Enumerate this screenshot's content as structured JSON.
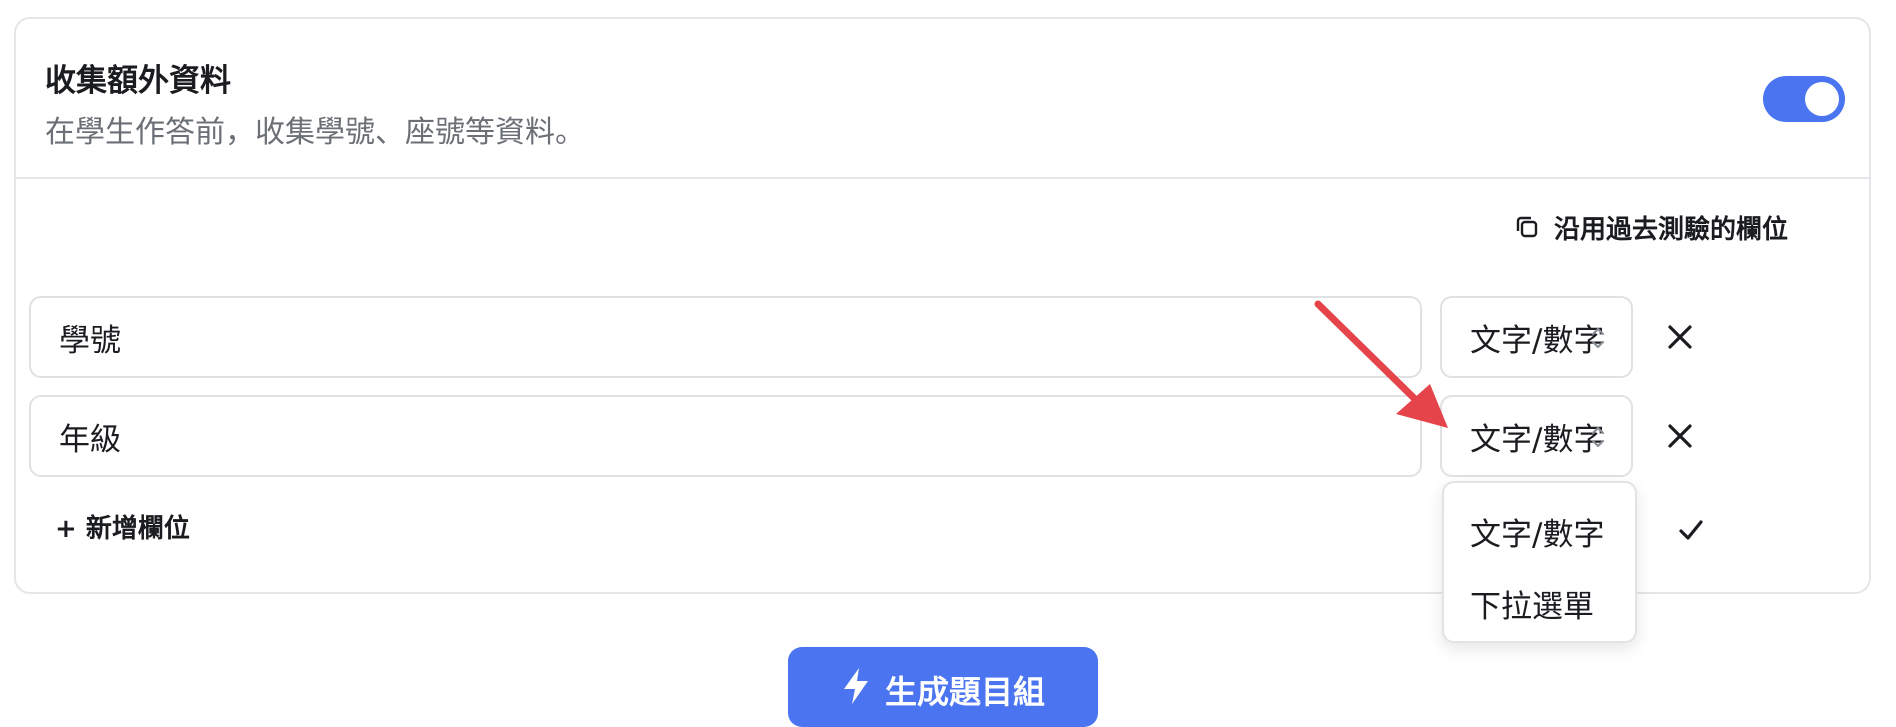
{
  "extra_info": {
    "title": "收集額外資料",
    "description": "在學生作答前，收集學號、座號等資料。",
    "enabled": true
  },
  "reuse_link": {
    "label": "沿用過去測驗的欄位",
    "icon": "copy-icon"
  },
  "fields": [
    {
      "name": "學號",
      "type": "文字/數字"
    },
    {
      "name": "年級",
      "type": "文字/數字"
    }
  ],
  "add_field_label": "+ 新增欄位",
  "dropdown": {
    "options": [
      {
        "label": "文字/數字",
        "selected": true
      },
      {
        "label": "下拉選單",
        "selected": false
      }
    ]
  },
  "generate_button": {
    "label": "生成題目組",
    "icon": "bolt-icon"
  },
  "colors": {
    "accent": "#4a74f0",
    "annotation_arrow": "#e5454a",
    "border": "#e4e6ea",
    "muted_text": "#6b6f76"
  }
}
